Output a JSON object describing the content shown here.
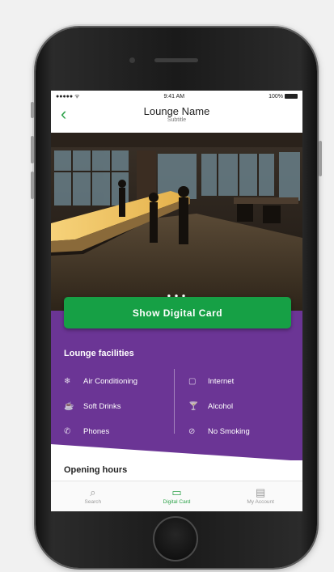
{
  "status_bar": {
    "signal": "●●●●● ᯤ",
    "time": "9:41 AM",
    "battery_label": "100%"
  },
  "nav": {
    "back_icon": "chevron-left-icon",
    "title": "Lounge Name",
    "subtitle": "Subtitle"
  },
  "hero": {
    "pager": "● ● ●"
  },
  "cta": {
    "label": "Show Digital Card"
  },
  "facilities": {
    "title": "Lounge facilities",
    "left": [
      {
        "icon": "air-conditioning-icon",
        "glyph": "❄",
        "label": "Air Conditioning"
      },
      {
        "icon": "soft-drinks-icon",
        "glyph": "☕",
        "label": "Soft Drinks"
      },
      {
        "icon": "phone-icon",
        "glyph": "✆",
        "label": "Phones"
      }
    ],
    "right": [
      {
        "icon": "internet-icon",
        "glyph": "▢",
        "label": "Internet"
      },
      {
        "icon": "alcohol-icon",
        "glyph": "🍸",
        "label": "Alcohol"
      },
      {
        "icon": "no-smoking-icon",
        "glyph": "⊘",
        "label": "No Smoking"
      }
    ]
  },
  "hours": {
    "title": "Opening hours"
  },
  "tabs": [
    {
      "label": "Search",
      "glyph": "⌕"
    },
    {
      "label": "Digital Card",
      "glyph": "▭"
    },
    {
      "label": "My Account",
      "glyph": "▤"
    }
  ],
  "colors": {
    "brand_green": "#16a045",
    "brand_purple": "#6b3595"
  }
}
